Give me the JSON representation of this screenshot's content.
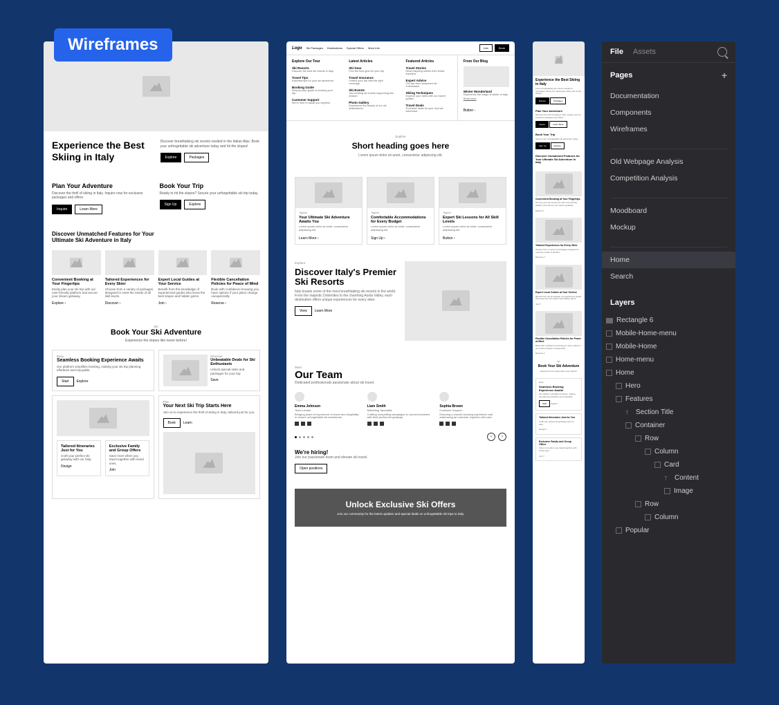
{
  "badge": "Wireframes",
  "frame1": {
    "hero_title": "Experience the Best Skiing in Italy",
    "hero_sub": "Discover breathtaking ski resorts nestled in the Italian Alps. Book your unforgettable ski adventure today and hit the slopes!",
    "btn_explore": "Explore",
    "btn_packages": "Packages",
    "plan_h": "Plan Your Adventure",
    "plan_d": "Discover the thrill of skiing in Italy. Inquire now for exclusive packages and offers.",
    "plan_b1": "Inquire",
    "plan_b2": "Learn More",
    "book_h": "Book Your Trip",
    "book_d": "Ready to hit the slopes? Secure your unforgettable ski trip today.",
    "book_b1": "Sign Up",
    "book_b2": "Explore",
    "feat_h": "Discover Unmatched Features for Your Ultimate Ski Adventure in Italy",
    "feat_cards": [
      {
        "t": "Convenient Booking at Your Fingertips",
        "d": "Easily plan your ski trip with our user-friendly platform and secure your dream getaway.",
        "l": "Explore"
      },
      {
        "t": "Tailored Experiences for Every Skier",
        "d": "Choose from a variety of packages designed to meet the needs of all skill levels.",
        "l": "Discover"
      },
      {
        "t": "Expert Local Guides at Your Service",
        "d": "Benefit from the knowledge of experienced guides who know the best slopes and hidden gems.",
        "l": "Join"
      },
      {
        "t": "Flexible Cancellation Policies for Peace of Mind",
        "d": "Book with confidence knowing you have options if your plans change unexpectedly.",
        "l": "Reserve"
      }
    ],
    "ski_tag": "Ski",
    "ski_h": "Book Your Ski Adventure",
    "ski_sub": "Experience the slopes like never before!",
    "bc": [
      {
        "tag": "Easy",
        "t": "Seamless Booking Experience Awaits",
        "d": "Our platform simplifies booking, making your ski trip planning effortless and enjoyable.",
        "b1": "Start",
        "b2": "Explore"
      },
      {
        "tag": "Discover",
        "t": "Unbeatable Deals for Ski Enthusiasts",
        "d": "Unlock special rates and packages for your trip.",
        "b1": "Save"
      },
      {
        "tag": "Plan",
        "t": "Your Next Ski Trip Starts Here",
        "d": "Join us to experience the thrill of skiing in Italy, tailored just for you.",
        "b1": "Book",
        "b2": "Learn"
      }
    ],
    "sm": [
      {
        "t": "Tailored Itineraries Just for You",
        "d": "Craft your perfect ski getaway with our help.",
        "l": "Design"
      },
      {
        "t": "Exclusive Family and Group Offers",
        "d": "Save more when you travel together with loved ones.",
        "l": "Join"
      }
    ]
  },
  "frame2": {
    "logo": "Logo",
    "nav": [
      "Ski Packages",
      "Destinations",
      "Special Offers",
      "More Info"
    ],
    "nav_join": "Join",
    "nav_book": "Book",
    "mega": {
      "c1h": "Explore Our Tour",
      "c1": [
        {
          "t": "Ski Resorts",
          "d": "Discover the best ski resorts in Italy."
        },
        {
          "t": "Travel Tips",
          "d": "Essential tips for your ski adventure."
        },
        {
          "t": "Booking Guide",
          "d": "Step-by-step guide to booking your trip."
        },
        {
          "t": "Customer Support",
          "d": "We're here to assist you anytime."
        }
      ],
      "c2h": "Latest Articles",
      "c2": [
        {
          "t": "Ski Gear",
          "d": "Find the best gear for your trip."
        },
        {
          "t": "Travel Insurance",
          "d": "Protect your trip with the right coverage."
        },
        {
          "t": "Ski Events",
          "d": "Join exciting ski events happening this season."
        },
        {
          "t": "Photo Gallery",
          "d": "Experience the beauty of our ski destinations."
        }
      ],
      "c3h": "Featured Articles",
      "c3": [
        {
          "t": "Travel Stories",
          "d": "Read inspiring stories from fellow travelers."
        },
        {
          "t": "Expert Advice",
          "d": "Get tips from seasoned ski enthusiasts."
        },
        {
          "t": "Skiing Techniques",
          "d": "Improve your skills with our expert guides."
        },
        {
          "t": "Travel Deals",
          "d": "Exclusive deals for your next ski adventure."
        }
      ],
      "c4h": "From Our Blog",
      "c4t": "Winter Wonderland",
      "c4d": "Experience the magic of winter in Italy.",
      "c4l": "Read more",
      "c4b": "Button"
    },
    "explore_tag": "Explore",
    "explore_h": "Short heading goes here",
    "explore_sub": "Lorem ipsum dolor sit amet, consectetur adipiscing elit.",
    "ecards": [
      {
        "tag": "Tagline",
        "t": "Your Ultimate Ski Adventure Awaits You",
        "d": "Lorem ipsum dolor sit amet, consectetur adipiscing elit.",
        "l": "Learn More"
      },
      {
        "tag": "Tagline",
        "t": "Comfortable Accommodations for Every Budget",
        "d": "Lorem ipsum dolor sit amet, consectetur adipiscing elit.",
        "l": "Sign Up"
      },
      {
        "tag": "Tagline",
        "t": "Expert Ski Lessons for All Skill Levels",
        "d": "Lorem ipsum dolor sit amet, consectetur adipiscing elit.",
        "l": "Button"
      }
    ],
    "disc_tag": "Explore",
    "disc_h": "Discover Italy's Premier Ski Resorts",
    "disc_d": "Italy boasts some of the most breathtaking ski resorts in the world. From the majestic Dolomites to the charming Aosta Valley, each destination offers unique experiences for every skier.",
    "disc_b1": "View",
    "disc_b2": "Learn More",
    "team_tag": "Meet",
    "team_h": "Our Team",
    "team_sub": "Dedicated professionals passionate about ski travel.",
    "members": [
      {
        "n": "Emma Johnson",
        "r": "Team Leader",
        "d": "Bringing years of experience in travel and hospitality to ensure unforgettable ski adventures."
      },
      {
        "n": "Liam Smith",
        "r": "Marketing Specialist",
        "d": "Crafting compelling campaigns to connect travelers with their perfect ski getaway."
      },
      {
        "n": "Sophia Brown",
        "r": "Customer Support",
        "d": "Ensuring a smooth booking experience and addressing all customer inquiries with care."
      }
    ],
    "hire_h": "We're hiring!",
    "hire_d": "Join our passionate team and elevate ski travel.",
    "hire_b": "Open positions",
    "cta_h": "Unlock Exclusive Ski Offers",
    "cta_d": "Join our community for the latest updates and special deals on unforgettable ski trips to Italy."
  },
  "frame3": {
    "s1": {
      "t": "Experience the Best Skiing in Italy",
      "d": "Lorem breathtaking ski resorts nestled in mountains. Book your adventure today and hit the slopes!",
      "b1": "Explore",
      "b2": "Packages"
    },
    "s2": {
      "t": "Plan Your Adventure",
      "d": "Discover the thrill of skiing in Italy. Inquire now for exclusive packages and offers.",
      "b1": "Inquire",
      "b2": "Learn More"
    },
    "s3": {
      "t": "Book Your Trip",
      "d": "Secure your unforgettable ski adventure today.",
      "b1": "Sign Up",
      "b2": "Explore"
    },
    "s4": {
      "t": "Discover Unmatched Features for Your Ultimate Ski Adventure in Italy"
    },
    "c1": {
      "t": "Convenient Booking at Your Fingertips",
      "d": "Our trip your ski experience with user-friendly platform and secure your dream getaway.",
      "l": "Explore"
    },
    "c2": {
      "t": "Tailored Experiences for Every Skier",
      "d": "Choose from a variety of packages designed to meet the needs of all skier.",
      "l": "Discover"
    },
    "c3": {
      "t": "Expert Local Guides at Your Service",
      "d": "Benefit from the knowledge of experienced guides who know the best slopes and hidden gems.",
      "l": "Join"
    },
    "c4": {
      "t": "Flexible Cancellation Policies for Peace of Mind",
      "d": "Book with confidence knowing you have options if your plans change unexpectedly.",
      "l": "Reserve"
    },
    "ski": {
      "tag": "Ski",
      "t": "Book Your Ski Adventure",
      "d": "Experience the slopes like never before!"
    },
    "b1": {
      "tag": "Easy",
      "t": "Seamless Booking Experience Awaits",
      "d": "Our platform simplifies booking, making ski planning effortless and enjoyable.",
      "b1": "Start",
      "b2": "Search"
    },
    "b2": {
      "t": "Tailored Itineraries Just for You",
      "d": "Craft your perfect ski getaway with our help.",
      "l": "Design"
    },
    "b3": {
      "t": "Exclusive Family and Group Offers",
      "d": "Save more when you travel together with loved ones.",
      "l": "Join"
    }
  },
  "panel": {
    "tabs": [
      "File",
      "Assets"
    ],
    "pages_h": "Pages",
    "pages": [
      "Documentation",
      "Components",
      "Wireframes"
    ],
    "pages2": [
      "Old Webpage Analysis",
      "Competition Analysis"
    ],
    "pages3": [
      "Moodboard",
      "Mockup"
    ],
    "pages4": [
      "Home",
      "Search"
    ],
    "selected": "Home",
    "layers_h": "Layers",
    "tree": [
      {
        "n": "Rectangle 6",
        "i": 0,
        "t": "rect"
      },
      {
        "n": "Mobile-Home-menu",
        "i": 0,
        "t": "frame"
      },
      {
        "n": "Mobile-Home",
        "i": 0,
        "t": "frame"
      },
      {
        "n": "Home-menu",
        "i": 0,
        "t": "frame"
      },
      {
        "n": "Home",
        "i": 0,
        "t": "frame"
      },
      {
        "n": "Hero",
        "i": 1,
        "t": "frame"
      },
      {
        "n": "Features",
        "i": 1,
        "t": "frame"
      },
      {
        "n": "Section Title",
        "i": 2,
        "t": "text"
      },
      {
        "n": "Container",
        "i": 2,
        "t": "frame"
      },
      {
        "n": "Row",
        "i": 3,
        "t": "frame"
      },
      {
        "n": "Column",
        "i": 4,
        "t": "frame"
      },
      {
        "n": "Card",
        "i": 5,
        "t": "frame"
      },
      {
        "n": "Content",
        "i": 6,
        "t": "text"
      },
      {
        "n": "Image",
        "i": 6,
        "t": "frame"
      },
      {
        "n": "Row",
        "i": 3,
        "t": "frame"
      },
      {
        "n": "Column",
        "i": 4,
        "t": "frame"
      },
      {
        "n": "Popular",
        "i": 1,
        "t": "frame"
      }
    ]
  }
}
